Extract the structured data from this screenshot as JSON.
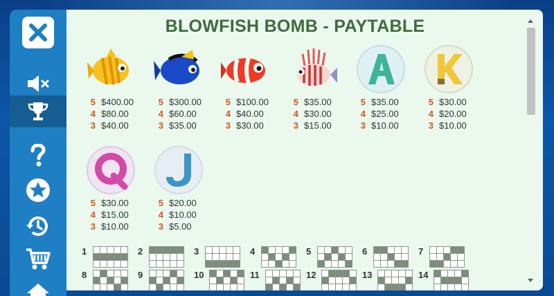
{
  "title": "BLOWFISH BOMB - PAYTABLE",
  "sidebar": [
    {
      "icon": "close-icon",
      "active": false
    },
    {
      "icon": "mute-icon",
      "active": false
    },
    {
      "icon": "trophy-icon",
      "active": true
    },
    {
      "icon": "help-icon",
      "active": false
    },
    {
      "icon": "star-icon",
      "active": false
    },
    {
      "icon": "history-icon",
      "active": false
    },
    {
      "icon": "cart-icon",
      "active": false
    },
    {
      "icon": "home-icon",
      "active": false
    }
  ],
  "symbols": [
    {
      "name": "yellow-fish",
      "pays": [
        {
          "count": "5",
          "value": "$400.00"
        },
        {
          "count": "4",
          "value": "$80.00"
        },
        {
          "count": "3",
          "value": "$40.00"
        }
      ]
    },
    {
      "name": "blue-fish",
      "pays": [
        {
          "count": "5",
          "value": "$300.00"
        },
        {
          "count": "4",
          "value": "$60.00"
        },
        {
          "count": "3",
          "value": "$35.00"
        }
      ]
    },
    {
      "name": "clownfish",
      "pays": [
        {
          "count": "5",
          "value": "$100.00"
        },
        {
          "count": "4",
          "value": "$40.00"
        },
        {
          "count": "3",
          "value": "$30.00"
        }
      ]
    },
    {
      "name": "lionfish",
      "pays": [
        {
          "count": "5",
          "value": "$35.00"
        },
        {
          "count": "4",
          "value": "$30.00"
        },
        {
          "count": "3",
          "value": "$15.00"
        }
      ]
    },
    {
      "name": "letter-a",
      "pays": [
        {
          "count": "5",
          "value": "$35.00"
        },
        {
          "count": "4",
          "value": "$25.00"
        },
        {
          "count": "3",
          "value": "$10.00"
        }
      ]
    },
    {
      "name": "letter-k",
      "pays": [
        {
          "count": "5",
          "value": "$30.00"
        },
        {
          "count": "4",
          "value": "$20.00"
        },
        {
          "count": "3",
          "value": "$10.00"
        }
      ]
    },
    {
      "name": "letter-q",
      "pays": [
        {
          "count": "5",
          "value": "$30.00"
        },
        {
          "count": "4",
          "value": "$15.00"
        },
        {
          "count": "3",
          "value": "$10.00"
        }
      ]
    },
    {
      "name": "letter-j",
      "pays": [
        {
          "count": "5",
          "value": "$20.00"
        },
        {
          "count": "4",
          "value": "$10.00"
        },
        {
          "count": "3",
          "value": "$5.00"
        }
      ]
    }
  ],
  "paylines": [
    {
      "number": "1",
      "rows": [
        1,
        1,
        1,
        1,
        1
      ]
    },
    {
      "number": "2",
      "rows": [
        0,
        0,
        0,
        0,
        0
      ]
    },
    {
      "number": "3",
      "rows": [
        2,
        2,
        2,
        2,
        2
      ]
    },
    {
      "number": "4",
      "rows": [
        0,
        1,
        2,
        1,
        0
      ]
    },
    {
      "number": "5",
      "rows": [
        2,
        1,
        0,
        1,
        2
      ]
    },
    {
      "number": "6",
      "rows": [
        0,
        0,
        1,
        2,
        2
      ]
    },
    {
      "number": "7",
      "rows": [
        2,
        2,
        1,
        0,
        0
      ]
    },
    {
      "number": "8",
      "rows": [
        1,
        0,
        1,
        2,
        1
      ]
    },
    {
      "number": "9",
      "rows": [
        1,
        2,
        1,
        0,
        1
      ]
    },
    {
      "number": "10",
      "rows": [
        0,
        1,
        0,
        1,
        0
      ]
    },
    {
      "number": "11",
      "rows": [
        2,
        1,
        2,
        1,
        2
      ]
    },
    {
      "number": "12",
      "rows": [
        1,
        0,
        0,
        0,
        1
      ]
    },
    {
      "number": "13",
      "rows": [
        1,
        2,
        2,
        2,
        1
      ]
    },
    {
      "number": "14",
      "rows": [
        0,
        1,
        1,
        1,
        0
      ]
    }
  ],
  "colors": {
    "title": "#3f6b3e",
    "pay_count": "#d0571e",
    "sidebar": "#1e7fc4",
    "panel": "#eaf8ee"
  }
}
